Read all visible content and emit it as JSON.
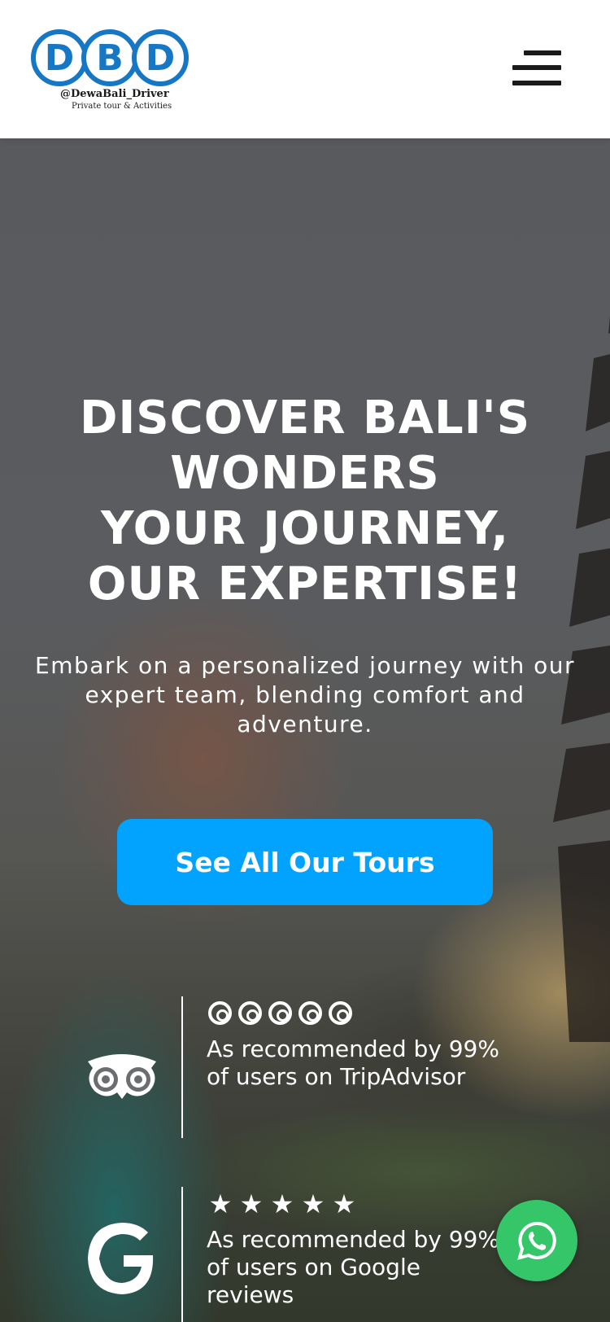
{
  "header": {
    "logo": {
      "letters": [
        "D",
        "B",
        "D"
      ],
      "handle": "@DewaBali_Driver",
      "tagline": "Private tour & Activities",
      "color": "#1677c4"
    },
    "menu_icon": "hamburger-menu-icon"
  },
  "hero": {
    "title_lines": [
      "DISCOVER BALI'S",
      "WONDERS",
      "YOUR JOURNEY,",
      "OUR EXPERTISE!"
    ],
    "subtitle": "Embark on a personalized journey with our expert team, blending comfort and adventure.",
    "cta_label": "See All Our Tours",
    "cta_color": "#01a3ff"
  },
  "reviews": [
    {
      "icon": "tripadvisor-owl-icon",
      "rating_icon": "tripadvisor-circle-icon",
      "rating": 5,
      "text": "As recommended by 99% of users on TripAdvisor"
    },
    {
      "icon": "google-g-icon",
      "rating_icon": "star-icon",
      "rating": 5,
      "text": "As recommended by 99% of users on Google reviews"
    }
  ],
  "floating": {
    "whatsapp_icon": "whatsapp-icon",
    "whatsapp_color": "#36c66a"
  }
}
